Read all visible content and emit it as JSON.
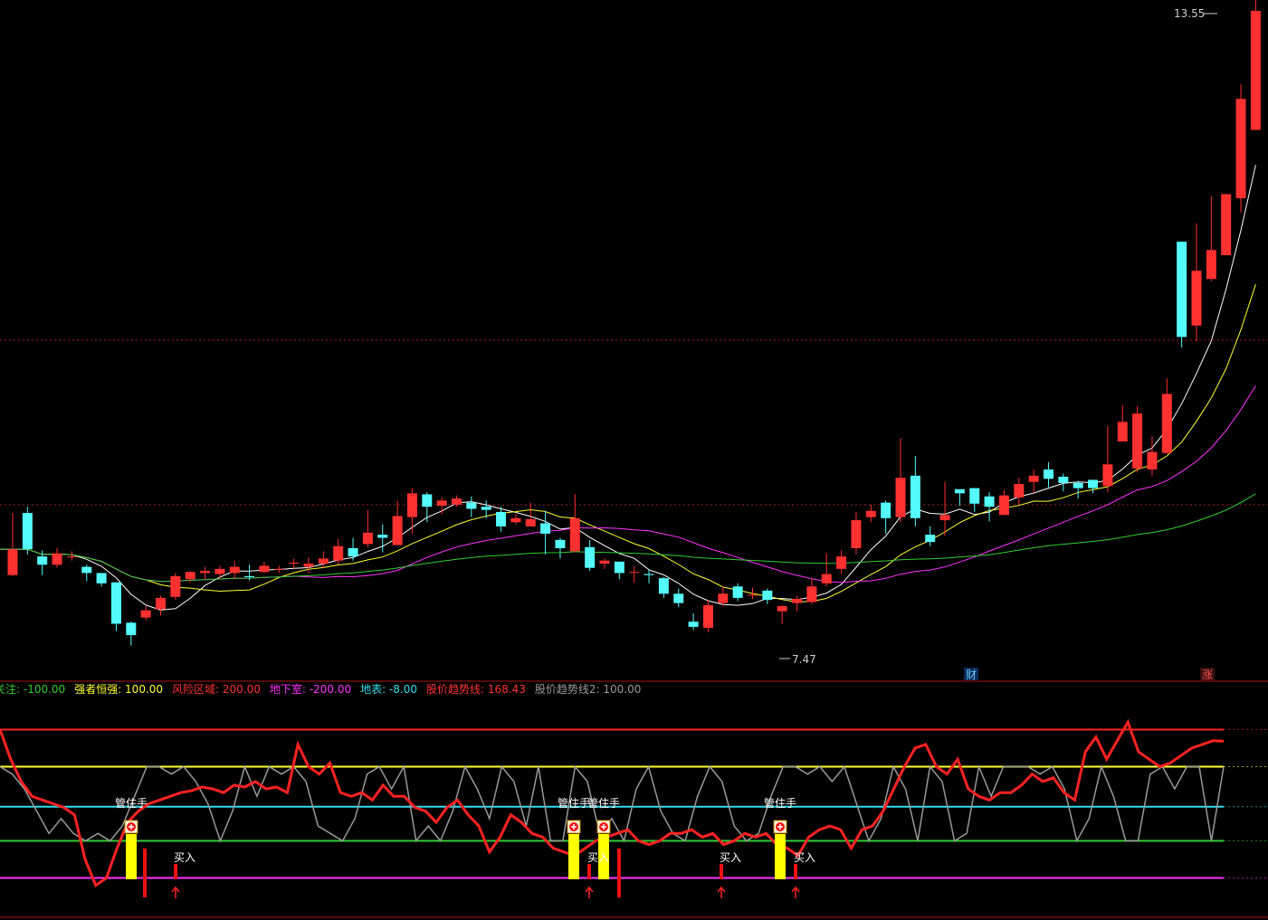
{
  "main_panel": {
    "header_text": "",
    "high_label": "13.55",
    "low_label": "7.47",
    "markers": [
      "财",
      "涨"
    ]
  },
  "indicator_panel": {
    "legend": [
      {
        "name": "关注",
        "value": "-100.00",
        "color": "#33cc33"
      },
      {
        "name": "强者恒强",
        "value": "100.00",
        "color": "#ffff33"
      },
      {
        "name": "风险区域",
        "value": "200.00",
        "color": "#ff3333"
      },
      {
        "name": "地下室",
        "value": "-200.00",
        "color": "#ff33ff"
      },
      {
        "name": "地表",
        "value": "-8.00",
        "color": "#33ddee"
      },
      {
        "name": "股价趋势线",
        "value": "168.43",
        "color": "#ff3333"
      },
      {
        "name": "股价趋势线2",
        "value": "100.00",
        "color": "#999999"
      }
    ],
    "signal_label": "管住手",
    "buy_label": "买入"
  },
  "chart_data": [
    {
      "type": "candlestick",
      "price_high": 13.55,
      "price_low": 7.47,
      "candles": [
        [
          8.1,
          8.35,
          8.7,
          8.09
        ],
        [
          8.7,
          8.35,
          8.76,
          8.3
        ],
        [
          8.28,
          8.2,
          8.34,
          8.1
        ],
        [
          8.2,
          8.31,
          8.36,
          8.17
        ],
        [
          8.28,
          8.28,
          8.33,
          8.24
        ],
        [
          8.18,
          8.12,
          8.2,
          8.04
        ],
        [
          8.12,
          8.02,
          8.12,
          7.99
        ],
        [
          8.03,
          7.63,
          8.03,
          7.56
        ],
        [
          7.64,
          7.52,
          7.65,
          7.42
        ],
        [
          7.69,
          7.76,
          7.8,
          7.66
        ],
        [
          7.77,
          7.88,
          7.9,
          7.71
        ],
        [
          7.89,
          8.09,
          8.12,
          7.86
        ],
        [
          8.06,
          8.13,
          8.14,
          8.03
        ],
        [
          8.12,
          8.14,
          8.18,
          8.06
        ],
        [
          8.11,
          8.16,
          8.19,
          8.07
        ],
        [
          8.12,
          8.18,
          8.24,
          8.07
        ],
        [
          8.09,
          8.08,
          8.2,
          8.05
        ],
        [
          8.13,
          8.19,
          8.23,
          8.12
        ],
        [
          8.16,
          8.16,
          8.19,
          8.12
        ],
        [
          8.21,
          8.22,
          8.26,
          8.16
        ],
        [
          8.18,
          8.21,
          8.27,
          8.12
        ],
        [
          8.21,
          8.26,
          8.33,
          8.17
        ],
        [
          8.24,
          8.38,
          8.45,
          8.2
        ],
        [
          8.36,
          8.28,
          8.46,
          8.24
        ],
        [
          8.4,
          8.51,
          8.73,
          8.37
        ],
        [
          8.49,
          8.46,
          8.59,
          8.32
        ],
        [
          8.39,
          8.67,
          8.82,
          8.42
        ],
        [
          8.66,
          8.89,
          8.94,
          8.5
        ],
        [
          8.88,
          8.76,
          8.9,
          8.61
        ],
        [
          8.77,
          8.82,
          8.85,
          8.69
        ],
        [
          8.78,
          8.84,
          8.87,
          8.76
        ],
        [
          8.8,
          8.74,
          8.86,
          8.66
        ],
        [
          8.76,
          8.73,
          8.82,
          8.65
        ],
        [
          8.71,
          8.57,
          8.76,
          8.52
        ],
        [
          8.61,
          8.65,
          8.69,
          8.59
        ],
        [
          8.57,
          8.64,
          8.8,
          8.6
        ],
        [
          8.6,
          8.5,
          8.72,
          8.3
        ],
        [
          8.44,
          8.36,
          8.46,
          8.26
        ],
        [
          8.33,
          8.65,
          8.88,
          8.32
        ],
        [
          8.37,
          8.17,
          8.44,
          8.14
        ],
        [
          8.21,
          8.24,
          8.26,
          8.16
        ],
        [
          8.23,
          8.12,
          8.21,
          8.06
        ],
        [
          8.13,
          8.13,
          8.19,
          8.03
        ],
        [
          8.11,
          8.1,
          8.15,
          8.02
        ],
        [
          8.07,
          7.92,
          8.08,
          7.88
        ],
        [
          7.92,
          7.83,
          7.97,
          7.79
        ],
        [
          7.65,
          7.6,
          7.73,
          7.57
        ],
        [
          7.59,
          7.81,
          7.86,
          7.55
        ],
        [
          7.83,
          7.92,
          7.99,
          7.8
        ],
        [
          7.99,
          7.88,
          8.02,
          7.85
        ],
        [
          7.91,
          7.91,
          7.98,
          7.87
        ],
        [
          7.95,
          7.86,
          7.97,
          7.82
        ],
        [
          7.75,
          7.8,
          7.81,
          7.63
        ],
        [
          7.83,
          7.87,
          7.9,
          7.75
        ],
        [
          7.84,
          7.99,
          8.07,
          7.82
        ],
        [
          8.02,
          8.11,
          8.31,
          7.99
        ],
        [
          8.16,
          8.28,
          8.34,
          8.11
        ],
        [
          8.36,
          8.63,
          8.71,
          8.3
        ],
        [
          8.66,
          8.72,
          8.78,
          8.61
        ],
        [
          8.8,
          8.65,
          8.82,
          8.5
        ],
        [
          8.66,
          9.04,
          9.42,
          8.61
        ],
        [
          9.06,
          8.65,
          9.25,
          8.57
        ],
        [
          8.49,
          8.42,
          8.57,
          8.38
        ],
        [
          8.63,
          8.68,
          9.0,
          8.48
        ],
        [
          8.93,
          8.89,
          8.89,
          8.77
        ],
        [
          8.94,
          8.79,
          8.9,
          8.71
        ],
        [
          8.86,
          8.76,
          8.9,
          8.62
        ],
        [
          8.68,
          8.87,
          8.92,
          8.68
        ],
        [
          8.85,
          8.98,
          9.04,
          8.78
        ],
        [
          9.0,
          9.06,
          9.12,
          8.89
        ],
        [
          9.12,
          9.03,
          9.19,
          8.95
        ],
        [
          9.05,
          8.99,
          9.08,
          8.91
        ],
        [
          8.99,
          8.94,
          9.01,
          8.84
        ],
        [
          9.02,
          8.94,
          9.0,
          8.89
        ],
        [
          8.96,
          9.17,
          9.54,
          8.9
        ],
        [
          9.39,
          9.58,
          9.74,
          9.45
        ],
        [
          9.13,
          9.66,
          9.73,
          9.09
        ],
        [
          9.12,
          9.29,
          9.44,
          9.06
        ],
        [
          9.28,
          9.85,
          10.0,
          9.27
        ],
        [
          11.32,
          10.4,
          11.32,
          10.3
        ],
        [
          10.51,
          11.04,
          11.5,
          10.36
        ],
        [
          10.96,
          11.24,
          11.76,
          10.94
        ],
        [
          11.19,
          11.78,
          11.31,
          11.19
        ],
        [
          11.74,
          12.7,
          12.84,
          11.6
        ],
        [
          12.4,
          13.55,
          14.0,
          12.78
        ]
      ],
      "moving_averages": [
        {
          "period": "MA5",
          "color": "#ffffff"
        },
        {
          "period": "MA10",
          "color": "#ffff33"
        },
        {
          "period": "MA20",
          "color": "#ff33ff"
        },
        {
          "period": "MA60",
          "color": "#33cc33"
        }
      ]
    },
    {
      "type": "line",
      "ylim": [
        -200,
        200
      ],
      "reference_lines": [
        200,
        100,
        -8,
        -100,
        -200
      ],
      "series": [
        {
          "name": "股价趋势线",
          "color": "#ff2222",
          "values": [
            200,
            120,
            60,
            20,
            10,
            0,
            -10,
            -30,
            -150,
            -220,
            -200,
            -120,
            -50,
            -20,
            0,
            10,
            20,
            30,
            35,
            45,
            40,
            30,
            50,
            45,
            60,
            40,
            45,
            30,
            160,
            100,
            80,
            110,
            30,
            20,
            30,
            10,
            50,
            20,
            20,
            -10,
            -20,
            -50,
            -10,
            10,
            -30,
            -60,
            -130,
            -90,
            -30,
            -50,
            -80,
            -90,
            -120,
            -130,
            -140,
            -120,
            -100,
            -90,
            -80,
            -70,
            -100,
            -110,
            -100,
            -80,
            -80,
            -70,
            -90,
            -80,
            -110,
            -100,
            -80,
            -90,
            -80,
            -110,
            -120,
            -140,
            -90,
            -70,
            -60,
            -70,
            -120,
            -70,
            -60,
            -20,
            40,
            100,
            150,
            160,
            100,
            80,
            120,
            40,
            20,
            10,
            30,
            30,
            50,
            80,
            60,
            70,
            30,
            10,
            140,
            180,
            120,
            170,
            220,
            140,
            120,
            100,
            110,
            130,
            150,
            160,
            170,
            168.43
          ]
        },
        {
          "name": "股价趋势线2",
          "color": "#999999",
          "values": [
            100,
            80,
            40,
            -20,
            -80,
            -40,
            -80,
            -100,
            -80,
            -100,
            -60,
            20,
            100,
            100,
            80,
            100,
            60,
            0,
            -100,
            -20,
            100,
            20,
            100,
            80,
            100,
            60,
            -60,
            -80,
            -100,
            -40,
            80,
            100,
            40,
            100,
            -100,
            -60,
            -100,
            -20,
            100,
            40,
            -40,
            100,
            60,
            -60,
            100,
            -100,
            -100,
            100,
            60,
            -80,
            -40,
            -100,
            40,
            100,
            -20,
            -80,
            -100,
            20,
            100,
            60,
            -60,
            -100,
            -80,
            20,
            100,
            100,
            80,
            100,
            60,
            100,
            0,
            -100,
            -40,
            100,
            40,
            -100,
            100,
            60,
            -100,
            -80,
            100,
            20,
            100,
            100,
            100,
            80,
            100,
            40,
            -100,
            -40,
            100,
            20,
            -100,
            -100,
            80,
            100,
            40,
            100,
            100,
            -100,
            100
          ]
        }
      ]
    }
  ]
}
